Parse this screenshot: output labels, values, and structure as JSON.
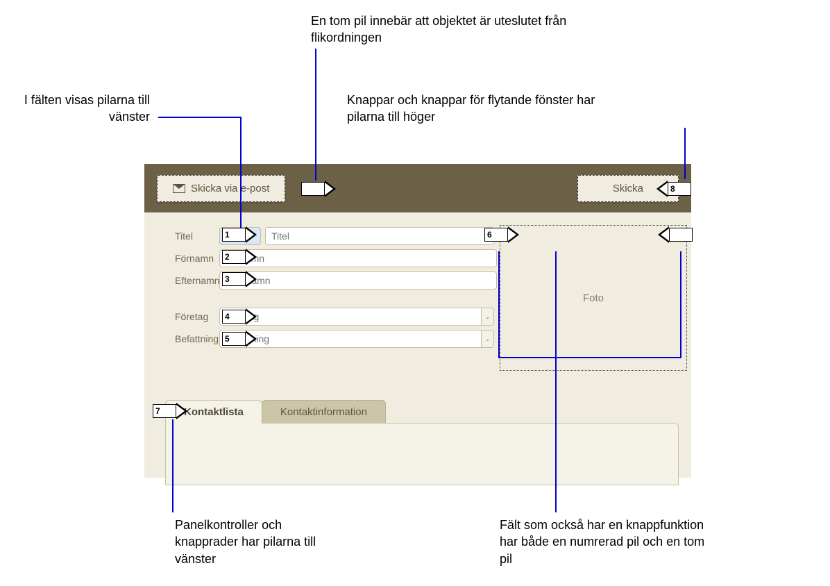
{
  "callouts": {
    "top_center": "En tom pil innebär att objektet är uteslutet från flikordningen",
    "left_upper": "I fälten visas pilarna till vänster",
    "right_upper": "Knappar och knappar för flytande fönster har pilarna till höger",
    "bottom_left": "Panelkontroller och knapprader har pilarna till vänster",
    "bottom_right": "Fält som också har en knappfunktion har både en numrerad pil och en tom pil"
  },
  "toolbar": {
    "email_button": "Skicka via e-post",
    "submit_button": "Skicka"
  },
  "form": {
    "rows": {
      "titel": {
        "label": "Titel",
        "placeholder": "Titel"
      },
      "fornamn": {
        "label": "Förnamn",
        "placeholder": "Förnamn"
      },
      "efternamn": {
        "label": "Efternamn",
        "placeholder": "Efternamn"
      },
      "foretag": {
        "label": "Företag",
        "placeholder": "Företag"
      },
      "befattning": {
        "label": "Befattning",
        "placeholder": "Befattning"
      }
    },
    "foto_label": "Foto"
  },
  "tabs": {
    "active": "Kontaktlista",
    "inactive": "Kontaktinformation"
  },
  "arrows": {
    "a1": "1",
    "a2": "2",
    "a3": "3",
    "a4": "4",
    "a5": "5",
    "a6": "6",
    "a7": "7",
    "a8": "8"
  }
}
